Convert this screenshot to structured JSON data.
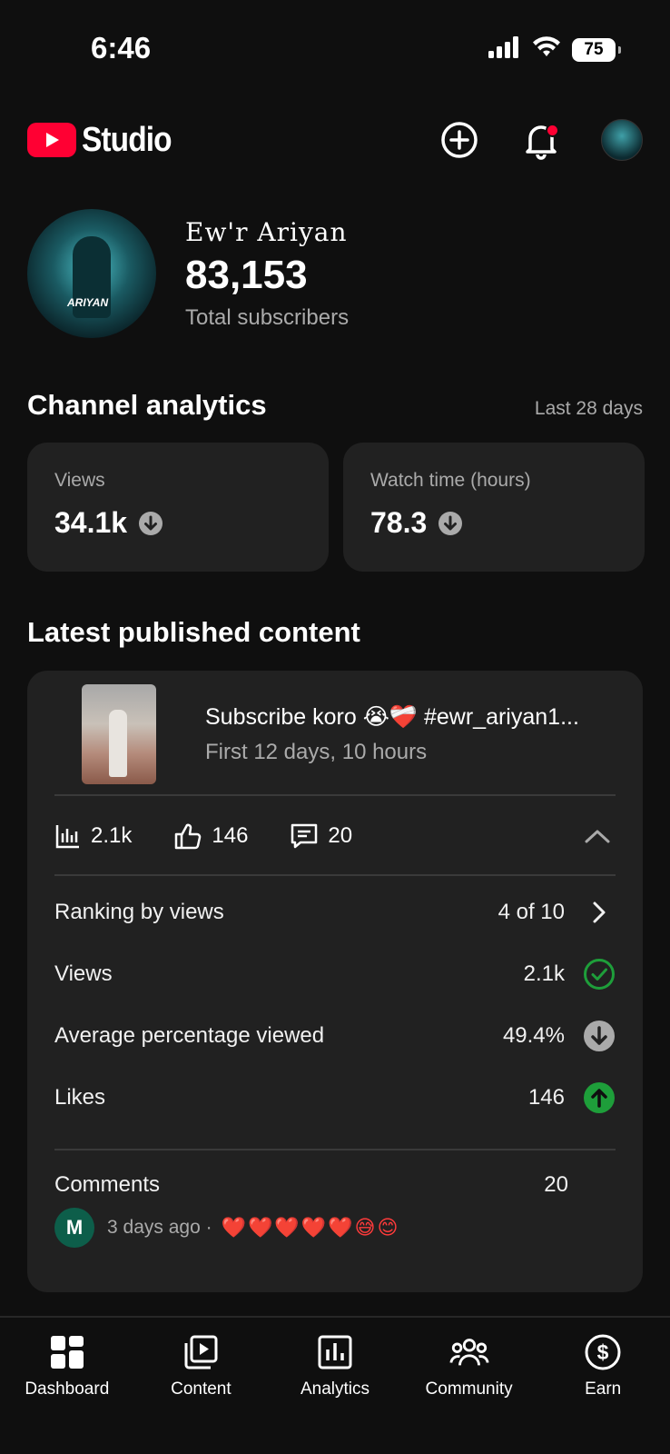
{
  "status": {
    "time": "6:46",
    "battery": "75"
  },
  "header": {
    "logo_text": "Studio"
  },
  "channel": {
    "name": "Ew'r Ariyan",
    "subscribers": "83,153",
    "subscribers_label": "Total subscribers",
    "avatar_tag": "ARIYAN"
  },
  "analytics": {
    "title": "Channel analytics",
    "period": "Last 28 days",
    "cards": [
      {
        "label": "Views",
        "value": "34.1k",
        "trend": "down"
      },
      {
        "label": "Watch time (hours)",
        "value": "78.3",
        "trend": "down"
      }
    ]
  },
  "latest": {
    "title": "Latest published content",
    "video_title": "Subscribe koro 😭❤️‍🩹 #ewr_ariyan1...",
    "video_meta": "First 12 days, 10 hours",
    "stats": {
      "views": "2.1k",
      "likes": "146",
      "comments": "20"
    },
    "details": [
      {
        "label": "Ranking by views",
        "value": "4 of 10",
        "icon": "chevron-right-icon"
      },
      {
        "label": "Views",
        "value": "2.1k",
        "icon": "check-circle-icon"
      },
      {
        "label": "Average percentage viewed",
        "value": "49.4%",
        "icon": "arrow-down-circle-icon"
      },
      {
        "label": "Likes",
        "value": "146",
        "icon": "arrow-up-circle-icon"
      }
    ],
    "comments_label": "Comments",
    "comments_count": "20",
    "comment": {
      "avatar_letter": "M",
      "time": "3 days ago ·",
      "text": "❤️❤️❤️❤️❤️😅😊"
    }
  },
  "nav": [
    {
      "label": "Dashboard",
      "icon": "dashboard-icon"
    },
    {
      "label": "Content",
      "icon": "content-icon"
    },
    {
      "label": "Analytics",
      "icon": "analytics-icon"
    },
    {
      "label": "Community",
      "icon": "community-icon"
    },
    {
      "label": "Earn",
      "icon": "earn-icon"
    }
  ],
  "colors": {
    "accent": "#ff0033",
    "background": "#0f0f0f",
    "card": "#212121",
    "positive": "#1e9e3a",
    "muted": "#aaaaaa"
  }
}
